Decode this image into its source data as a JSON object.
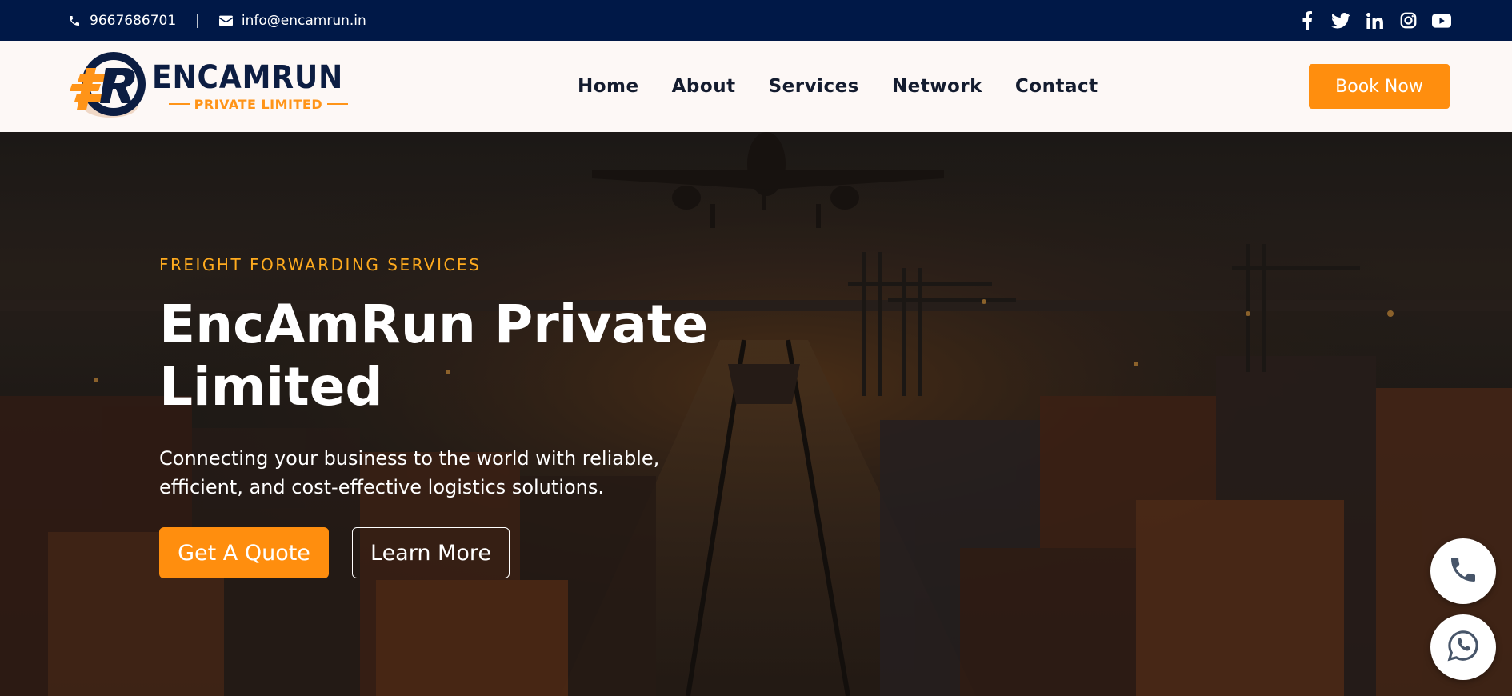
{
  "topbar": {
    "phone": "9667686701",
    "separator": "|",
    "email": "info@encamrun.in",
    "social_icons": [
      "facebook-icon",
      "twitter-icon",
      "linkedin-icon",
      "instagram-icon",
      "youtube-icon"
    ]
  },
  "header": {
    "logo": {
      "name": "ENCAMRUN",
      "subtitle": "PRIVATE LIMITED"
    },
    "nav": [
      "Home",
      "About",
      "Services",
      "Network",
      "Contact"
    ],
    "book_label": "Book Now"
  },
  "hero": {
    "eyebrow": "FREIGHT FORWARDING SERVICES",
    "title": "EncAmRun Private Limited",
    "lead": "Connecting your business to the world with reliable, efficient, and cost-effective logistics solutions.",
    "quote_label": "Get A Quote",
    "learn_label": "Learn More"
  },
  "floating": [
    "phone-icon",
    "whatsapp-icon"
  ],
  "colors": {
    "navy": "#001847",
    "accent": "#ff8e0e",
    "eyebrow": "#ffab1e",
    "header_bg": "#fdf8f6"
  }
}
